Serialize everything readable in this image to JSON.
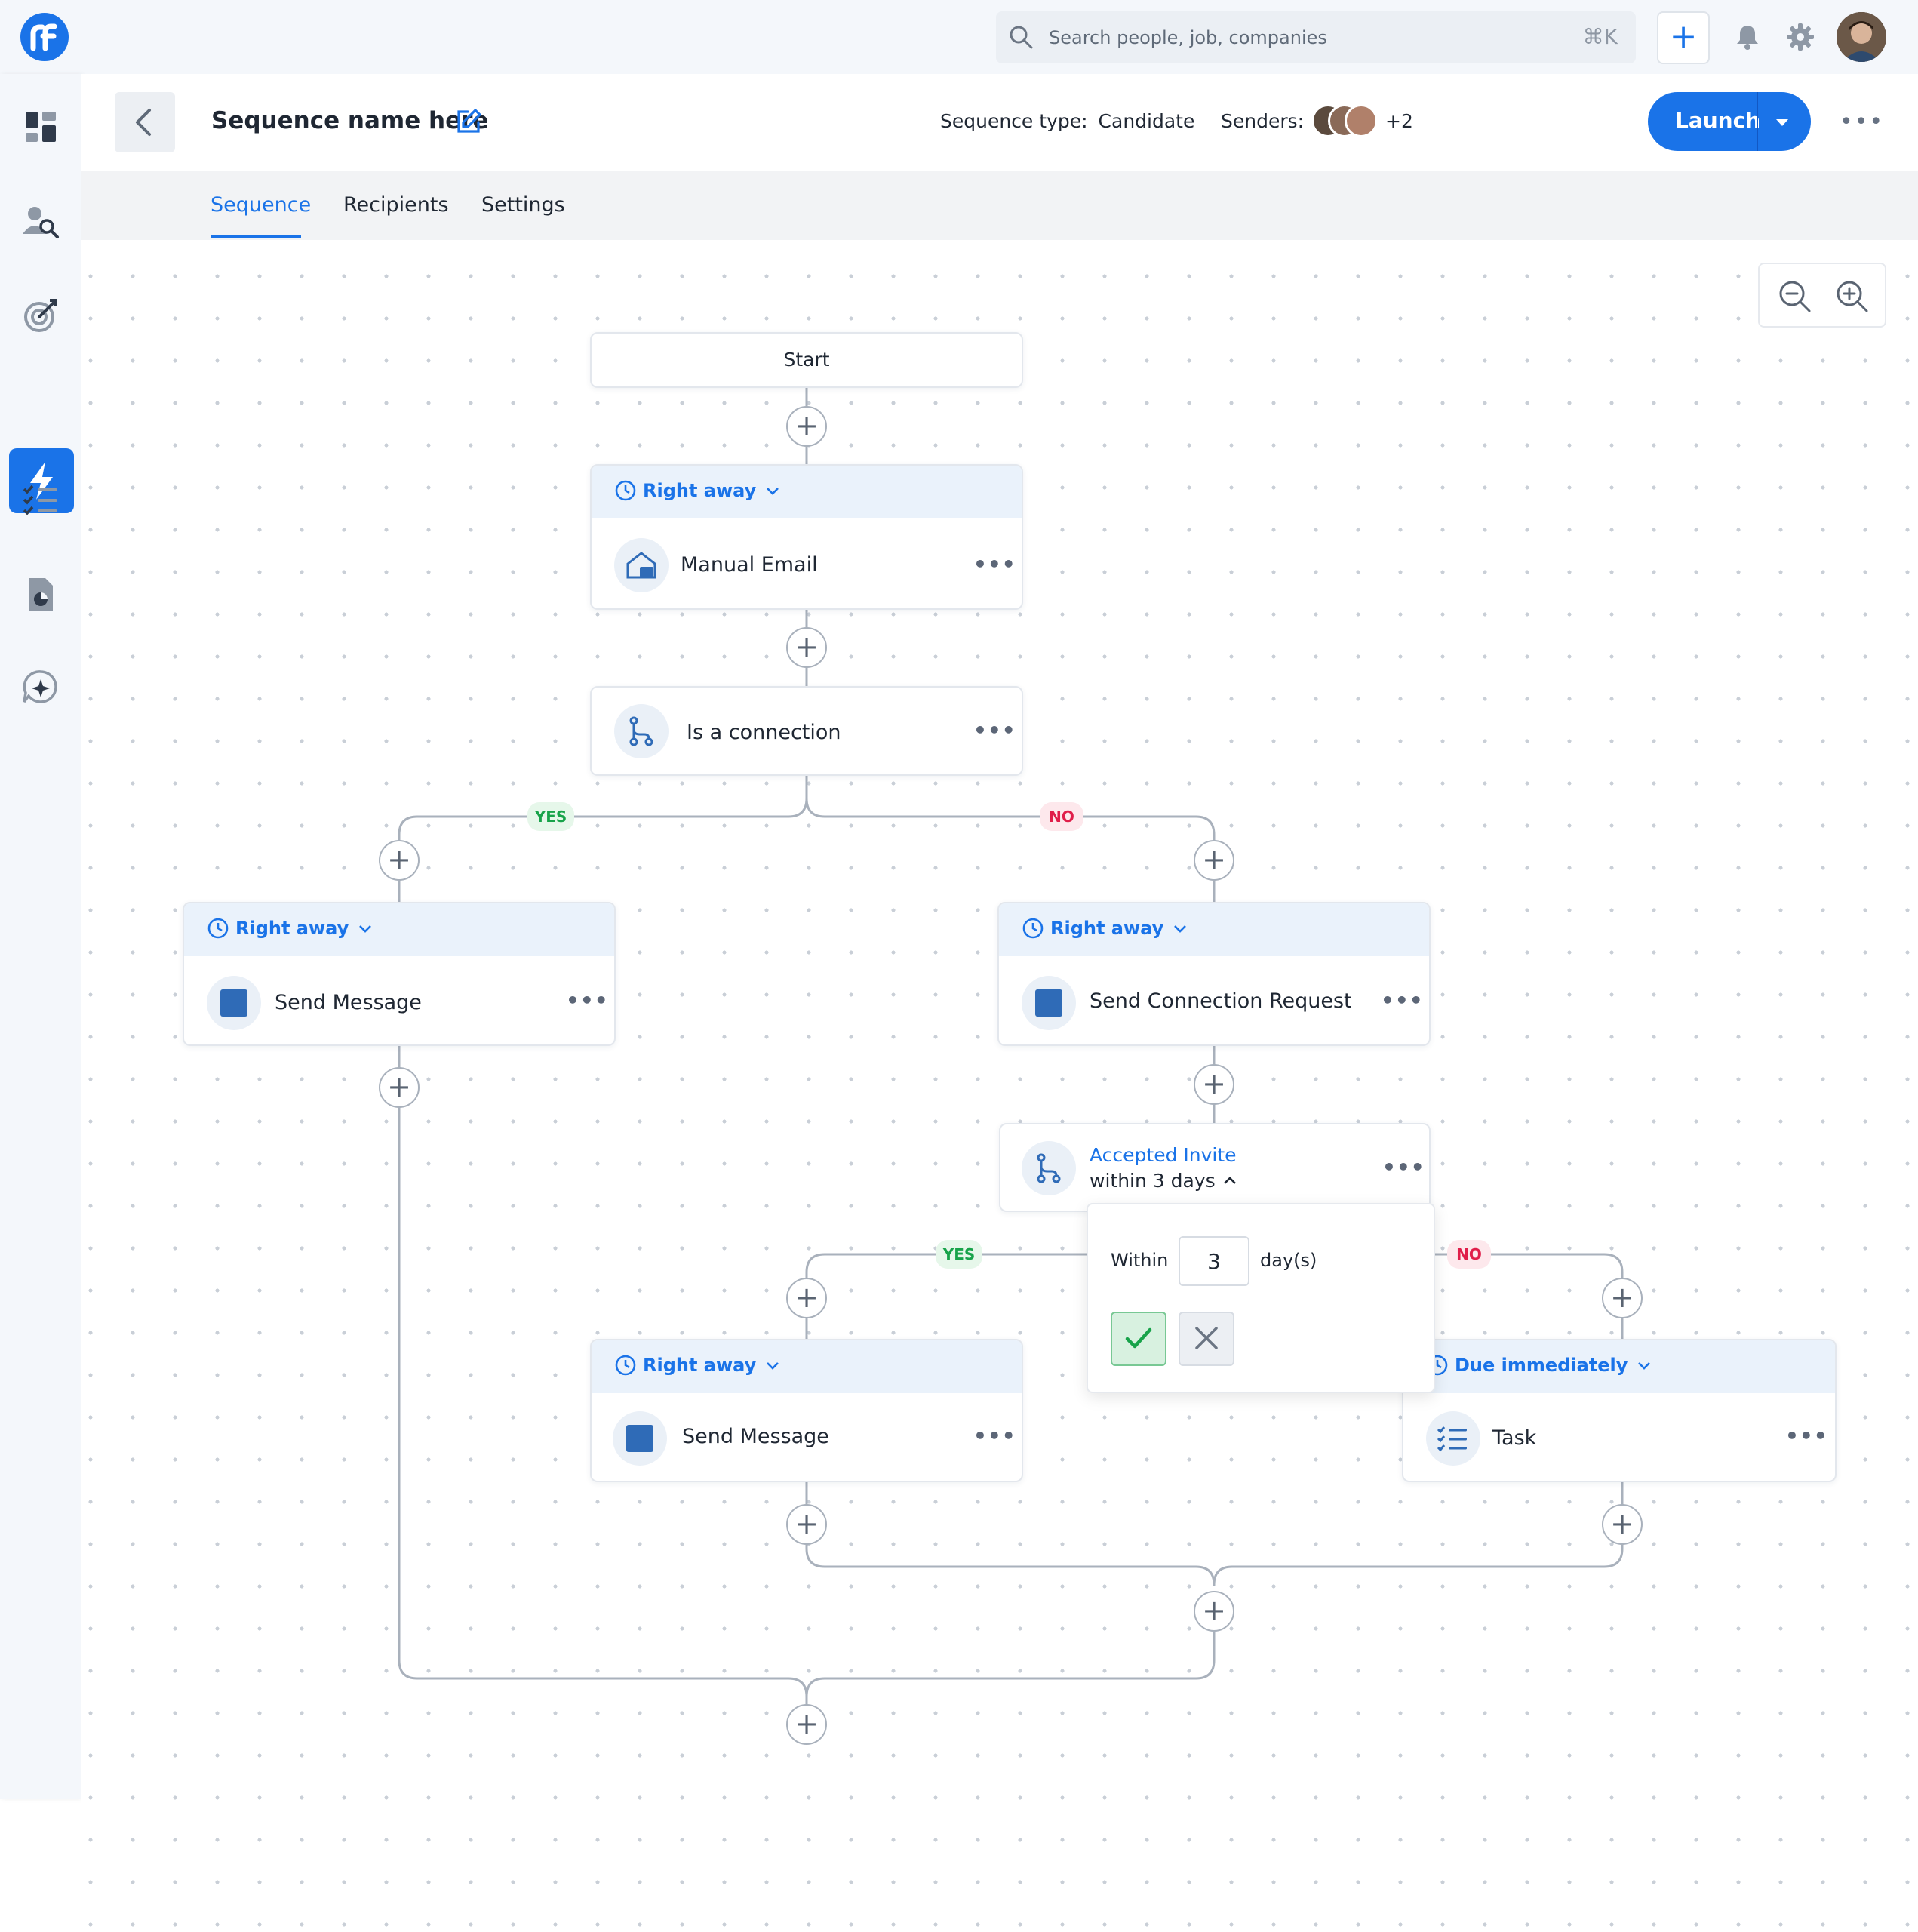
{
  "topbar": {
    "search_placeholder": "Search people, job, companies",
    "shortcut": "⌘K",
    "add_label": "+"
  },
  "header": {
    "title": "Sequence name here",
    "sequence_type_label": "Sequence type:",
    "sequence_type_value": "Candidate",
    "senders_label": "Senders:",
    "senders_extra": "+2",
    "launch_label": "Launch"
  },
  "tabs": [
    {
      "label": "Sequence",
      "active": true
    },
    {
      "label": "Recipients",
      "active": false
    },
    {
      "label": "Settings",
      "active": false
    }
  ],
  "sidebar": {
    "items": [
      "dashboard-icon",
      "people-search-icon",
      "target-icon",
      "lightning-icon",
      "checklist-icon",
      "report-icon",
      "ai-chat-icon"
    ],
    "active_item": "lightning-icon"
  },
  "flow": {
    "start": "Start",
    "manual_email": {
      "timing": "Right away",
      "label": "Manual Email"
    },
    "is_connection": {
      "label": "Is a connection"
    },
    "yes_label": "YES",
    "no_label": "NO",
    "send_message_left": {
      "timing": "Right away",
      "label": "Send Message"
    },
    "send_connection": {
      "timing": "Right away",
      "label": "Send Connection Request"
    },
    "accepted_invite": {
      "title": "Accepted Invite",
      "subtitle": "within 3 days"
    },
    "send_message_mid": {
      "timing": "Right away",
      "label": "Send Message"
    },
    "task": {
      "timing": "Due immediately",
      "label": "Task"
    },
    "more_label": "•••"
  },
  "popover": {
    "within_label": "Within",
    "value": "3",
    "unit": "day(s)"
  },
  "colors": {
    "accent": "#1a73e8",
    "yes": "#18a34a",
    "no": "#e01e4a",
    "node_icon": "#2f6bb7"
  }
}
